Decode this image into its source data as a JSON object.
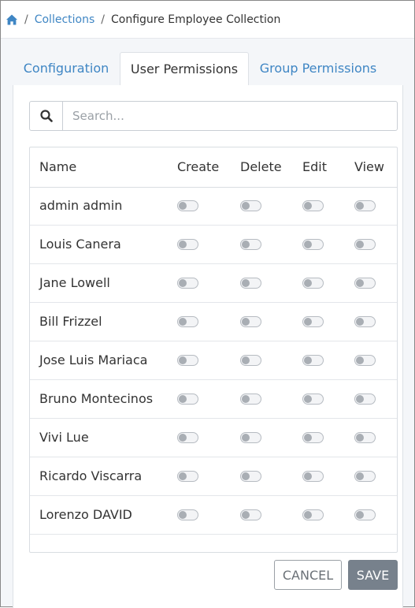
{
  "breadcrumb": {
    "home_icon": "home-icon",
    "separator": "/",
    "collections": "Collections",
    "current": "Configure Employee Collection"
  },
  "tabs": [
    {
      "label": "Configuration",
      "active": false
    },
    {
      "label": "User Permissions",
      "active": true
    },
    {
      "label": "Group Permissions",
      "active": false
    }
  ],
  "search": {
    "placeholder": "Search...",
    "value": "",
    "icon": "search-icon"
  },
  "table": {
    "columns": [
      "Name",
      "Create",
      "Delete",
      "Edit",
      "View"
    ],
    "rows": [
      {
        "name": "admin admin",
        "create": false,
        "delete": false,
        "edit": false,
        "view": false
      },
      {
        "name": "Louis Canera",
        "create": false,
        "delete": false,
        "edit": false,
        "view": false
      },
      {
        "name": "Jane Lowell",
        "create": false,
        "delete": false,
        "edit": false,
        "view": false
      },
      {
        "name": "Bill Frizzel",
        "create": false,
        "delete": false,
        "edit": false,
        "view": false
      },
      {
        "name": "Jose Luis Mariaca",
        "create": false,
        "delete": false,
        "edit": false,
        "view": false
      },
      {
        "name": "Bruno Montecinos",
        "create": false,
        "delete": false,
        "edit": false,
        "view": false
      },
      {
        "name": "Vivi Lue",
        "create": false,
        "delete": false,
        "edit": false,
        "view": false
      },
      {
        "name": "Ricardo Viscarra",
        "create": false,
        "delete": false,
        "edit": false,
        "view": false
      },
      {
        "name": "Lorenzo DAVID",
        "create": false,
        "delete": false,
        "edit": false,
        "view": false
      }
    ]
  },
  "actions": {
    "cancel_label": "CANCEL",
    "save_label": "SAVE"
  },
  "colors": {
    "link": "#3f86c4",
    "save_bg": "#77818c",
    "toggle_off": "#a9aeb4"
  }
}
